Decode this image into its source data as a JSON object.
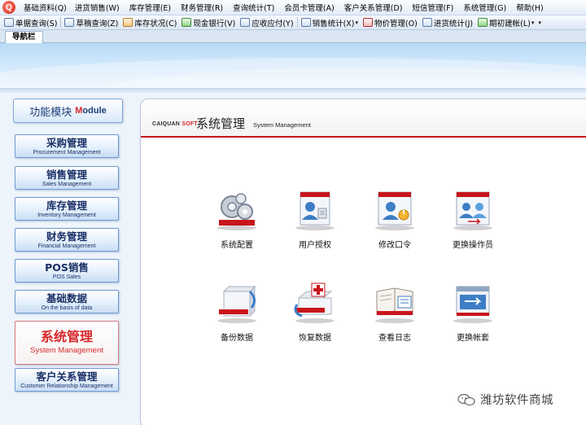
{
  "menubar": {
    "items": [
      "基础资料(Q)",
      "进货销售(W)",
      "库存管理(E)",
      "财务管理(R)",
      "查询统计(T)",
      "会员卡管理(A)",
      "客户关系管理(D)",
      "短信管理(F)",
      "系统管理(G)",
      "帮助(H)"
    ]
  },
  "toolbar": {
    "buttons": [
      "单据查询(S)",
      "草稿查询(Z)",
      "库存状况(C)",
      "现金银行(V)",
      "应收应付(Y)",
      "销售统计(X)",
      "物价管理(O)",
      "进货统计(J)",
      "期初建帐(L)"
    ]
  },
  "nav": {
    "tab": "导航栏"
  },
  "sidebar": {
    "header_cn": "功能模块",
    "header_en_first": "M",
    "header_en_rest": "odule",
    "modules": [
      {
        "cn": "采购管理",
        "en": "Procurement Management"
      },
      {
        "cn": "销售管理",
        "en": "Sales Management"
      },
      {
        "cn": "库存管理",
        "en": "Inventory Management"
      },
      {
        "cn": "财务管理",
        "en": "Financial Management"
      },
      {
        "cn": "POS销售",
        "en": "POS Sales"
      },
      {
        "cn": "基础数据",
        "en": "On the basis of data"
      },
      {
        "cn": "系统管理",
        "en": "System Management"
      },
      {
        "cn": "客户关系管理",
        "en": "Customer Relationship Management"
      }
    ],
    "active_module": "系统管理"
  },
  "panel": {
    "brand": "CAIQUAN",
    "brand_soft": "SOFT",
    "title": "系统管理",
    "title_en": "System Management",
    "functions": [
      {
        "label": "系统配置",
        "icon": "gears-icon"
      },
      {
        "label": "用户授权",
        "icon": "user-authorize-icon"
      },
      {
        "label": "修改口令",
        "icon": "change-password-icon"
      },
      {
        "label": "更换操作员",
        "icon": "switch-operator-icon"
      },
      {
        "label": "备份数据",
        "icon": "backup-box-icon"
      },
      {
        "label": "恢复数据",
        "icon": "restore-box-icon"
      },
      {
        "label": "查看日志",
        "icon": "log-book-icon"
      },
      {
        "label": "更换帐套",
        "icon": "switch-account-set-icon"
      }
    ]
  },
  "watermark": {
    "text": "潍坊软件商城"
  },
  "colors": {
    "accent_red": "#d8262a",
    "nav_blue": "#1a2f66",
    "panel_redline": "#c8151c"
  }
}
